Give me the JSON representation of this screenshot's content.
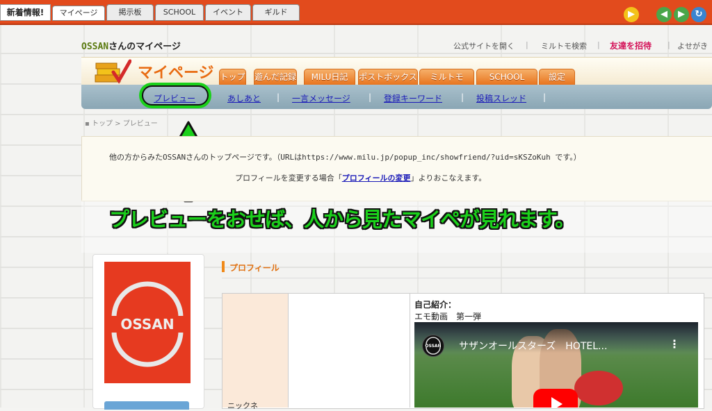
{
  "topbar": {
    "news_label": "新着情報!",
    "tabs": [
      "マイページ",
      "掲示板",
      "SCHOOL",
      "イベント",
      "ギルド"
    ]
  },
  "header": {
    "username": "OSSAN",
    "title_suffix": "さんのマイページ",
    "links": [
      "公式サイトを開く",
      "ミルトモ検索",
      "友達を招待",
      "よせがき"
    ],
    "separator": "|"
  },
  "mypage": {
    "title": "マイページ",
    "tabs": [
      "トップ",
      "遊んだ記録",
      "MILU日記",
      "ポストボックス",
      "ミルトモ",
      "SCHOOL",
      "設定"
    ]
  },
  "subnav": {
    "items": [
      "プレビュー",
      "あしあと",
      "一言メッセージ",
      "登録キーワード",
      "投稿スレッド"
    ],
    "separator": "|"
  },
  "breadcrumb": "トップ > プレビュー",
  "info": {
    "line1": "他の方からみたOSSANさんのトップページです。（URLはhttps://www.milu.jp/popup_inc/showfriend/?uid=sKSZoKuh です。）",
    "line2_prefix": "プロフィールを変更する場合「",
    "line2_link": "プロフィールの変更",
    "line2_suffix": "」よりおこなえます。"
  },
  "callout": "プレビューをおせば、人から見たマイペが見れます。",
  "profile": {
    "heading": "プロフィール",
    "label_cell": "ニックネ",
    "intro_label": "自己紹介：",
    "intro_text": "エモ動画　第一弾",
    "video_title": "サザンオールスターズ　HOTEL...",
    "side_logo_text": "OSSAN",
    "channel_logo_text": "OSSAN"
  },
  "colors": {
    "topbar": "#e24b1d",
    "accent_orange": "#e86a10",
    "highlight_green": "#1bd01b",
    "link_blue": "#1a1ab8"
  }
}
